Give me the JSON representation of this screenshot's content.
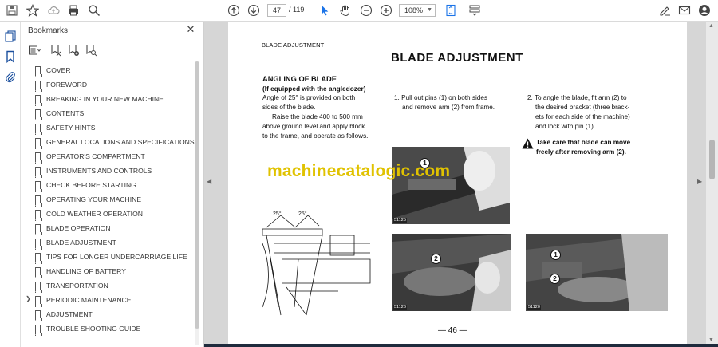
{
  "toolbar": {
    "page_current": "47",
    "page_total": "/ 119",
    "zoom": "108%"
  },
  "bookmarks": {
    "title": "Bookmarks",
    "items": [
      {
        "label": "COVER"
      },
      {
        "label": "FOREWORD"
      },
      {
        "label": "BREAKING IN YOUR NEW MACHINE"
      },
      {
        "label": "CONTENTS"
      },
      {
        "label": "SAFETY HINTS"
      },
      {
        "label": "GENERAL LOCATIONS AND SPECIFICATIONS"
      },
      {
        "label": "OPERATOR'S COMPARTMENT"
      },
      {
        "label": "INSTRUMENTS AND CONTROLS"
      },
      {
        "label": "CHECK BEFORE STARTING"
      },
      {
        "label": "OPERATING YOUR MACHINE"
      },
      {
        "label": "COLD WEATHER OPERATION"
      },
      {
        "label": "BLADE OPERATION"
      },
      {
        "label": "BLADE ADJUSTMENT"
      },
      {
        "label": "TIPS FOR LONGER UNDERCARRIAGE LIFE"
      },
      {
        "label": "HANDLING OF BATTERY"
      },
      {
        "label": "TRANSPORTATION"
      },
      {
        "label": "PERIODIC MAINTENANCE",
        "expandable": true
      },
      {
        "label": "ADJUSTMENT"
      },
      {
        "label": "TROUBLE SHOOTING GUIDE"
      }
    ]
  },
  "page": {
    "running_header": "BLADE ADJUSTMENT",
    "title": "BLADE ADJUSTMENT",
    "subheading": "ANGLING OF BLADE",
    "subheading2": "(If equipped with the angledozer)",
    "col1_line1": "Angle of 25° is provided on both",
    "col1_line2": "sides of the blade.",
    "col1_line3": "Raise the blade 400 to 500 mm",
    "col1_line4": "above ground level and apply block",
    "col1_line5": "to the frame, and operate as follows.",
    "step1_line1": "1. Pull out pins (1) on both sides",
    "step1_line2": "and remove arm (2) from frame.",
    "step2_line1": "2. To angle the blade, fit arm (2) to",
    "step2_line2": "the desired bracket (three brack-",
    "step2_line3": "ets for each side of the machine)",
    "step2_line4": "and lock with pin (1).",
    "warning_line1": "Take care that blade can move",
    "warning_line2": "freely after removing arm (2).",
    "diagram_angle_left": "25°",
    "diagram_angle_right": "25°",
    "photo1_id": "51125",
    "photo2_id": "51126",
    "photo3_id": "51120",
    "callout_1": "1",
    "callout_2": "2",
    "page_number": "— 46 —",
    "watermark": "machinecatalogic.com"
  },
  "colors": {
    "watermark": "#e0c200",
    "doc_background": "#d6d6d6",
    "bottom_bar": "#1f2b3d"
  }
}
